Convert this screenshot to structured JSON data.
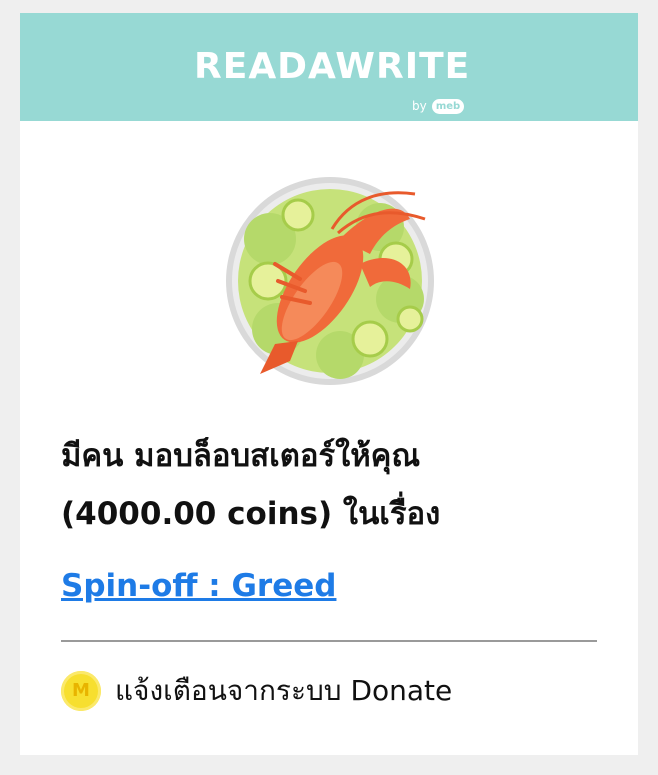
{
  "brand": {
    "logo_text": "READAWRITE",
    "by_text": "by",
    "sub_brand": "meb"
  },
  "gift": {
    "icon": "lobster-plate-icon"
  },
  "message": {
    "line1": "มีคน มอบล็อบสเตอร์ให้คุณ",
    "line2": "(4000.00 coins) ในเรื่อง",
    "story_title": "Spin-off : Greed"
  },
  "footer": {
    "coin_icon": "m-coin-icon",
    "coin_letter": "M",
    "label": "แจ้งเตือนจากระบบ Donate"
  },
  "colors": {
    "header_bg": "#97d9d4",
    "link": "#1e7be6",
    "coin": "#f7df2f"
  }
}
